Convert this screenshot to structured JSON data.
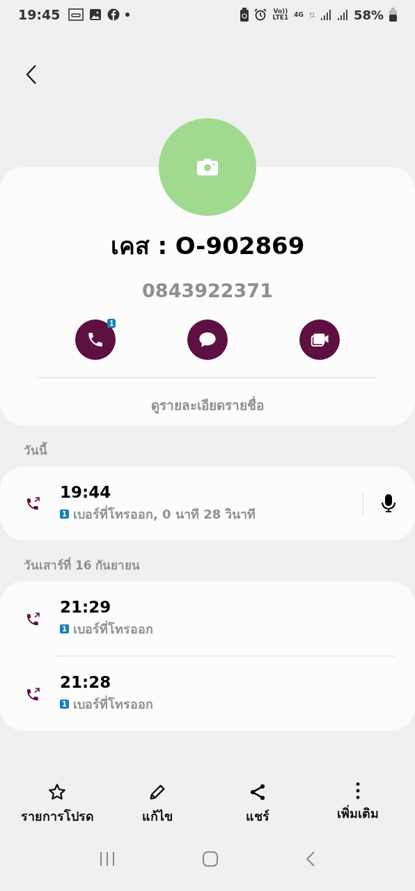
{
  "status_bar": {
    "time": "19:45",
    "volte": "Vo))",
    "lte": "LTE1",
    "network": "4G",
    "battery": "58%"
  },
  "contact": {
    "name": "เคส : O-902869",
    "number": "0843922371",
    "details_link": "ดูรายละเอียดรายชื่อ",
    "actions": [
      {
        "kind": "call",
        "badge": "1"
      },
      {
        "kind": "message"
      },
      {
        "kind": "video"
      }
    ]
  },
  "call_groups": [
    {
      "date": "วันนี้",
      "calls": [
        {
          "time": "19:44",
          "sim": "1",
          "description": "เบอร์ที่โทรออก, 0 นาที 28 วินาที",
          "recording": true
        }
      ]
    },
    {
      "date": "วันเสาร์ที่ 16 กันยายน",
      "calls": [
        {
          "time": "21:29",
          "sim": "1",
          "description": "เบอร์ที่โทรออก",
          "recording": false
        },
        {
          "time": "21:28",
          "sim": "1",
          "description": "เบอร์ที่โทรออก",
          "recording": false
        }
      ]
    }
  ],
  "bottom_actions": [
    {
      "kind": "favorite",
      "label": "รายการโปรด"
    },
    {
      "kind": "edit",
      "label": "แก้ไข"
    },
    {
      "kind": "share",
      "label": "แชร์"
    },
    {
      "kind": "more",
      "label": "เพิ่มเติม"
    }
  ]
}
